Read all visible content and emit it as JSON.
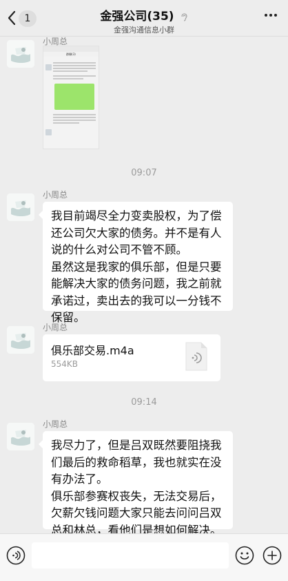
{
  "header": {
    "unread_count": "1",
    "title": "金强公司(35)",
    "subtitle": "金强沟通信息小群",
    "back_icon": "chevron-left-icon",
    "mute_icon": "ear-icon",
    "more_icon": "more-dots-icon"
  },
  "messages": [
    {
      "sender": "小周总",
      "type": "image",
      "image_title": "群聊(3)"
    },
    {
      "type": "timestamp",
      "time": "09:07"
    },
    {
      "sender": "小周总",
      "type": "text",
      "paragraphs": [
        "我目前竭尽全力变卖股权，为了偿还公司欠大家的债务。并不是有人说的什么对公司不管不顾。",
        "虽然这是我家的俱乐部，但是只要能解决大家的债务问题，我之前就承诺过，卖出去的我可以一分钱不保留。"
      ]
    },
    {
      "sender": "小周总",
      "type": "file",
      "file_name": "俱乐部交易.m4a",
      "file_size": "554KB",
      "file_icon": "audio-file-icon"
    },
    {
      "type": "timestamp",
      "time": "09:14"
    },
    {
      "sender": "小周总",
      "type": "text",
      "paragraphs": [
        "我尽力了，但是吕双既然要阻挠我们最后的救命稻草，我也就实在没有办法了。",
        "俱乐部参赛权丧失，无法交易后，欠薪欠钱问题大家只能去问问吕双总和林总，看他们是想如何解决。"
      ]
    }
  ],
  "input_bar": {
    "voice_icon": "voice-icon",
    "emoji_icon": "emoji-icon",
    "plus_icon": "plus-icon"
  },
  "colors": {
    "background": "#ededed",
    "bubble": "#ffffff",
    "green_bubble": "#9ce46b"
  }
}
